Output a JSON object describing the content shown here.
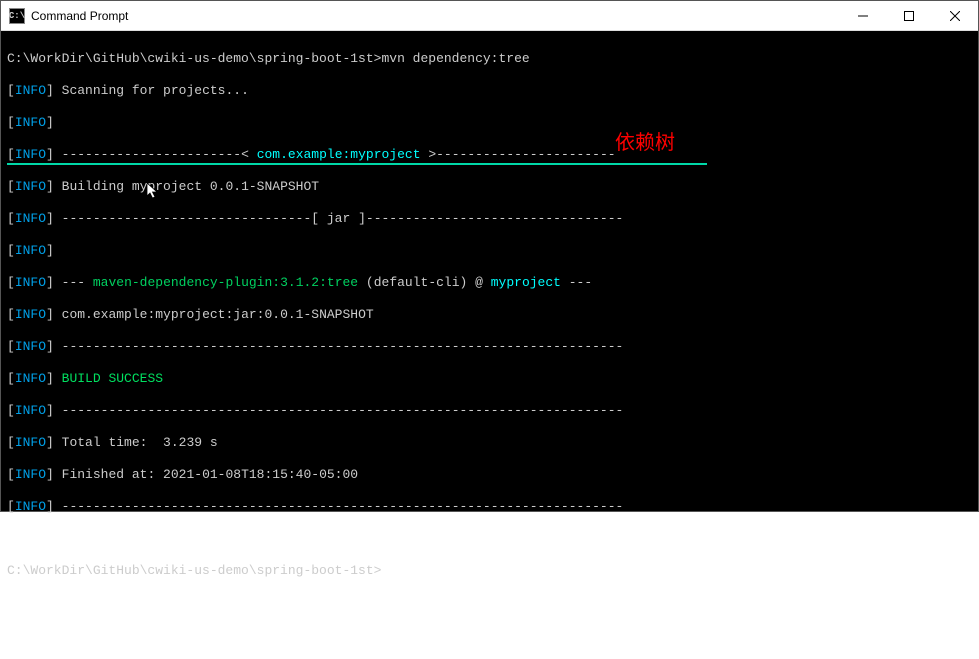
{
  "window": {
    "title": "Command Prompt",
    "icon_label": "C:\\"
  },
  "prompt_path": "C:\\WorkDir\\GitHub\\cwiki-us-demo\\spring-boot-1st>",
  "command": "mvn dependency:tree",
  "lines": {
    "scanning": "Scanning for projects...",
    "header_prefix": "-----------------------< ",
    "header_project": "com.example:myproject",
    "header_suffix": " >-----------------------",
    "building": "Building myproject 0.0.1-SNAPSHOT",
    "jar_line": "--------------------------------[ jar ]---------------------------------",
    "dash72": "------------------------------------------------------------------------",
    "plugin_prefix": "--- ",
    "plugin": "maven-dependency-plugin:3.1.2:tree",
    "plugin_mid": " (default-cli) @ ",
    "plugin_project": "myproject",
    "plugin_suffix": " ---",
    "jar_artifact": "com.example:myproject:jar:0.0.1-SNAPSHOT",
    "build_success": "BUILD SUCCESS",
    "total_time": "Total time:  3.239 s",
    "finished_at": "Finished at: 2021-01-08T18:15:40-05:00"
  },
  "annotation": "依赖树",
  "bracket_open": "[",
  "bracket_close": "] ",
  "info_label": "INFO"
}
